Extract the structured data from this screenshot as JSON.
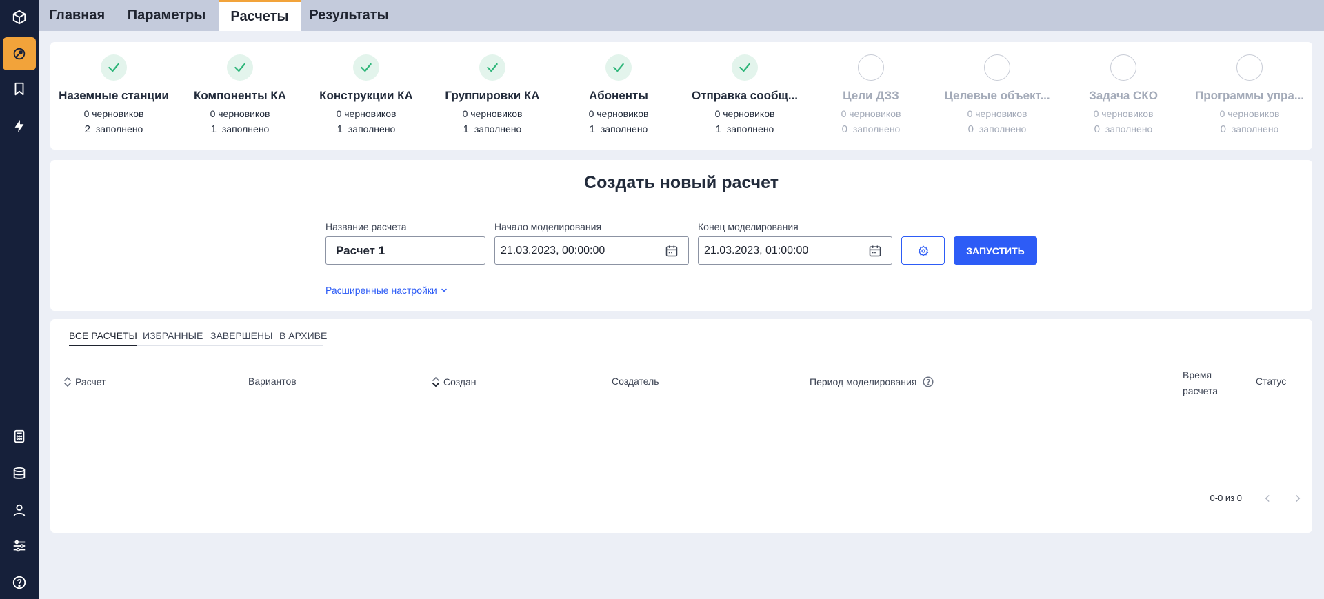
{
  "sidebar": {
    "items": [
      {
        "name": "cube-icon",
        "active": false
      },
      {
        "name": "orbit-icon",
        "active": true
      },
      {
        "name": "bookmark-icon",
        "active": false
      },
      {
        "name": "lightning-icon",
        "active": false
      },
      {
        "name": "calculator-icon",
        "active": false
      },
      {
        "name": "database-icon",
        "active": false
      },
      {
        "name": "user-icon",
        "active": false
      },
      {
        "name": "sliders-icon",
        "active": false
      },
      {
        "name": "help-icon",
        "active": false
      }
    ]
  },
  "tabs": [
    {
      "label": "Главная",
      "active": false
    },
    {
      "label": "Параметры",
      "active": false
    },
    {
      "label": "Расчеты",
      "active": true
    },
    {
      "label": "Результаты",
      "active": false
    }
  ],
  "steps": [
    {
      "title": "Наземные станции",
      "drafts_count": "0",
      "drafts_label": "черновиков",
      "filled_count": "2",
      "filled_label": "заполнено",
      "done": true
    },
    {
      "title": "Компоненты КА",
      "drafts_count": "0",
      "drafts_label": "черновиков",
      "filled_count": "1",
      "filled_label": "заполнено",
      "done": true
    },
    {
      "title": "Конструкции КА",
      "drafts_count": "0",
      "drafts_label": "черновиков",
      "filled_count": "1",
      "filled_label": "заполнено",
      "done": true
    },
    {
      "title": "Группировки КА",
      "drafts_count": "0",
      "drafts_label": "черновиков",
      "filled_count": "1",
      "filled_label": "заполнено",
      "done": true
    },
    {
      "title": "Абоненты",
      "drafts_count": "0",
      "drafts_label": "черновиков",
      "filled_count": "1",
      "filled_label": "заполнено",
      "done": true
    },
    {
      "title": "Отправка сообщ...",
      "drafts_count": "0",
      "drafts_label": "черновиков",
      "filled_count": "1",
      "filled_label": "заполнено",
      "done": true
    },
    {
      "title": "Цели ДЗЗ",
      "drafts_count": "0",
      "drafts_label": "черновиков",
      "filled_count": "0",
      "filled_label": "заполнено",
      "done": false
    },
    {
      "title": "Целевые объект...",
      "drafts_count": "0",
      "drafts_label": "черновиков",
      "filled_count": "0",
      "filled_label": "заполнено",
      "done": false
    },
    {
      "title": "Задача СКО",
      "drafts_count": "0",
      "drafts_label": "черновиков",
      "filled_count": "0",
      "filled_label": "заполнено",
      "done": false
    },
    {
      "title": "Программы упра...",
      "drafts_count": "0",
      "drafts_label": "черновиков",
      "filled_count": "0",
      "filled_label": "заполнено",
      "done": false
    }
  ],
  "create": {
    "title": "Создать новый расчет",
    "name_label": "Название расчета",
    "name_value": "Расчет 1",
    "start_label": "Начало моделирования",
    "start_value": "21.03.2023, 00:00:00",
    "end_label": "Конец моделирования",
    "end_value": "21.03.2023, 01:00:00",
    "run_label": "ЗАПУСТИТЬ",
    "advanced_label": "Расширенные настройки"
  },
  "list": {
    "tabs": [
      {
        "label": "ВСЕ РАСЧЕТЫ",
        "active": true
      },
      {
        "label": "ИЗБРАННЫЕ",
        "active": false
      },
      {
        "label": "ЗАВЕРШЕНЫ",
        "active": false
      },
      {
        "label": "В АРХИВЕ",
        "active": false
      }
    ],
    "columns": {
      "calc": "Расчет",
      "variants": "Вариантов",
      "created": "Создан",
      "creator": "Создатель",
      "period": "Период моделирования",
      "time_line1": "Время",
      "time_line2": "расчета",
      "status": "Статус"
    },
    "pager_text": "0-0 из 0"
  },
  "colors": {
    "sidebar_bg": "#16203a",
    "accent_orange": "#f2a33a",
    "primary_blue": "#2d5cf6",
    "success_green": "#2fb67a",
    "page_bg": "#eceff6"
  }
}
